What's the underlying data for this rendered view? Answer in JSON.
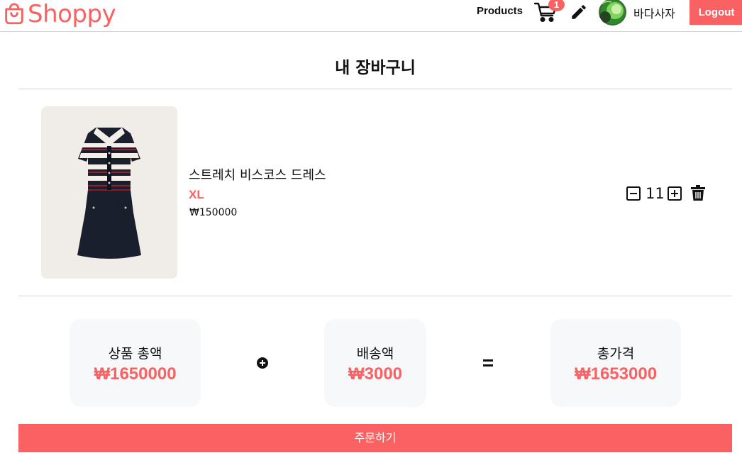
{
  "header": {
    "logo_text": "Shoppy",
    "nav_products": "Products",
    "cart_count": "1",
    "username": "바다사자",
    "logout_label": "Logout"
  },
  "page": {
    "title": "내 장바구니"
  },
  "cart": {
    "items": [
      {
        "name": "스트레치 비스코스 드레스",
        "size": "XL",
        "price": "₩150000",
        "quantity": "11"
      }
    ]
  },
  "summary": {
    "products_label": "상품 총액",
    "products_value": "₩1650000",
    "shipping_label": "배송액",
    "shipping_value": "₩3000",
    "total_label": "총가격",
    "total_value": "₩1653000"
  },
  "order_button_label": "주문하기",
  "colors": {
    "accent": "#f96162",
    "card_bg": "#f7f8fa",
    "divider": "#d4d4d4"
  }
}
